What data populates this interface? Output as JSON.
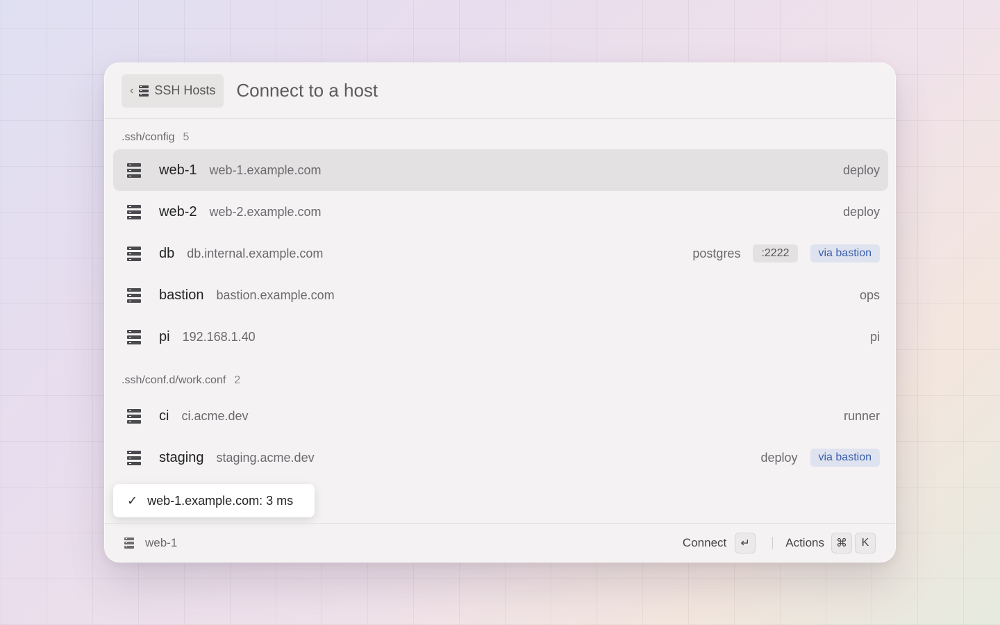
{
  "header": {
    "back_label": "SSH Hosts",
    "back_chevron": "‹",
    "back_icon": "server-icon",
    "title": "Connect to a host"
  },
  "groups": [
    {
      "label": ".ssh/config",
      "count": "5",
      "hosts": [
        {
          "name": "web-1",
          "host": "web-1.example.com",
          "user": "deploy",
          "selected": true
        },
        {
          "name": "web-2",
          "host": "web-2.example.com",
          "user": "deploy"
        },
        {
          "name": "db",
          "host": "db.internal.example.com",
          "user": "postgres",
          "port": ":2222",
          "via": "via bastion"
        },
        {
          "name": "bastion",
          "host": "bastion.example.com",
          "user": "ops"
        },
        {
          "name": "pi",
          "host": "192.168.1.40",
          "user": "pi"
        }
      ]
    },
    {
      "label": ".ssh/conf.d/work.conf",
      "count": "2",
      "hosts": [
        {
          "name": "ci",
          "host": "ci.acme.dev",
          "user": "runner"
        },
        {
          "name": "staging",
          "host": "staging.acme.dev",
          "user": "deploy",
          "via": "via bastion"
        }
      ]
    }
  ],
  "toast": {
    "check": "✓",
    "text": "web-1.example.com: 3 ms"
  },
  "footer": {
    "current": "web-1",
    "connect_label": "Connect",
    "connect_key": "↵",
    "actions_label": "Actions",
    "actions_keys": [
      "⌘",
      "K"
    ]
  },
  "colors": {
    "selected_row": "#e3e1e1",
    "via_tag_bg": "#dfe3f0",
    "via_tag_text": "#3b5fa8"
  }
}
